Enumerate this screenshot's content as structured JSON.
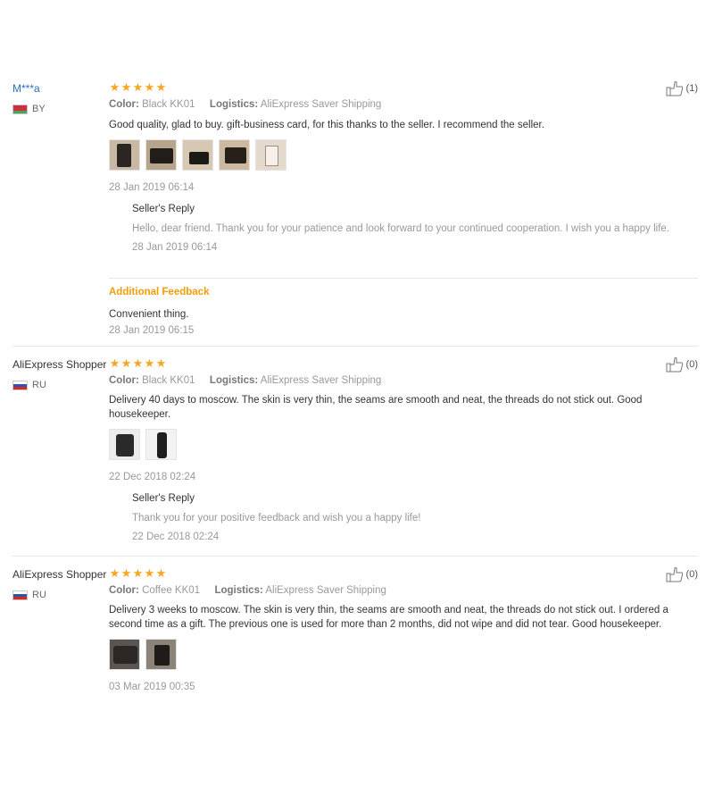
{
  "labels": {
    "color": "Color:",
    "logistics": "Logistics:",
    "seller_reply": "Seller's Reply",
    "additional_feedback": "Additional Feedback"
  },
  "reviews": [
    {
      "buyer": "M***a",
      "country": "BY",
      "stars": 5,
      "helpful": "(1)",
      "color_value": "Black KK01",
      "logistics_value": "AliExpress Saver Shipping",
      "content": "Good quality, glad to buy. gift-business card, for this thanks to the seller. I recommend the seller.",
      "photo_count": 5,
      "date": "28 Jan 2019 06:14",
      "reply_text": "Hello, dear friend. Thank you for your patience and look forward to your continued cooperation. I wish you a happy life.",
      "reply_date": "28 Jan 2019 06:14",
      "additional_text": "Convenient thing.",
      "additional_date": "28 Jan 2019 06:15"
    },
    {
      "buyer": "AliExpress Shopper",
      "country": "RU",
      "stars": 5,
      "helpful": "(0)",
      "color_value": "Black KK01",
      "logistics_value": "AliExpress Saver Shipping",
      "content": "Delivery 40 days to moscow. The skin is very thin, the seams are smooth and neat, the threads do not stick out. Good housekeeper.",
      "photo_count": 2,
      "date": "22 Dec 2018 02:24",
      "reply_text": "Thank you for your positive feedback and wish you a happy life!",
      "reply_date": "22 Dec 2018 02:24"
    },
    {
      "buyer": "AliExpress Shopper",
      "country": "RU",
      "stars": 5,
      "helpful": "(0)",
      "color_value": "Coffee KK01",
      "logistics_value": "AliExpress Saver Shipping",
      "content": "Delivery 3 weeks to moscow. The skin is very thin, the seams are smooth and neat, the threads do not stick out. I ordered a second time as a gift. The previous one is used for more than 2 months, did not wipe and did not tear. Good housekeeper.",
      "photo_count": 2,
      "date": "03 Mar 2019 00:35"
    }
  ],
  "colors": {
    "star": "#f5a623",
    "buyer_link": "#2a6ebb",
    "additional_feedback": "#f29d0a",
    "muted": "#999999",
    "divider": "#e8e8e8"
  },
  "icons": {
    "star": "star-icon",
    "thumbs_up": "thumbs-up-icon",
    "flag_by": "belarus-flag-icon",
    "flag_ru": "russia-flag-icon"
  }
}
